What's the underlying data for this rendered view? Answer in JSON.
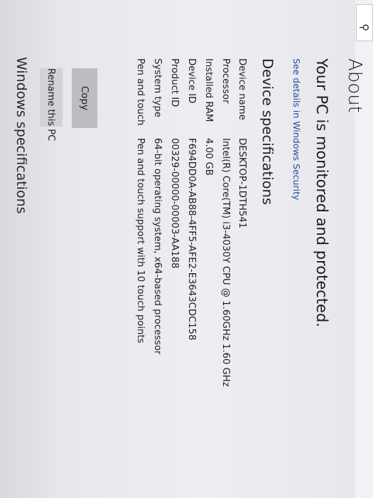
{
  "header": {
    "search_icon": "search-icon",
    "section_title": "About"
  },
  "protection": {
    "status": "Your PC is monitored and protected.",
    "link": "See details in Windows Security"
  },
  "device_specs": {
    "title": "Device specifications",
    "rows": [
      {
        "label": "Device name",
        "value": "DESKTOP-1DTH541"
      },
      {
        "label": "Processor",
        "value": "Intel(R) Core(TM) i3-4030Y CPU @ 1.60GHz   1.60 GHz"
      },
      {
        "label": "Installed RAM",
        "value": "4.00 GB"
      },
      {
        "label": "Device ID",
        "value": "F694DD0A-AB88-4FF5-AFE2-E3643CDC158"
      },
      {
        "label": "Product ID",
        "value": "00329-00000-00003-AA188"
      },
      {
        "label": "System type",
        "value": "64-bit operating system, x64-based processor"
      },
      {
        "label": "Pen and touch",
        "value": "Pen and touch support with 10 touch points"
      }
    ],
    "copy_label": "Copy",
    "rename_label": "Rename this PC"
  },
  "windows_specs": {
    "title": "Windows specifications"
  }
}
